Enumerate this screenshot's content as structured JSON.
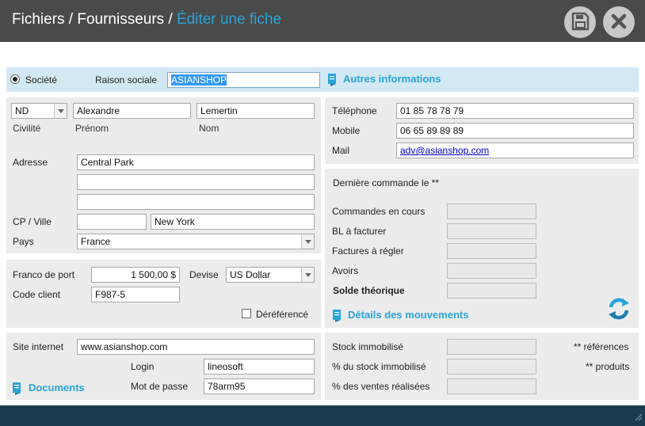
{
  "window": {
    "breadcrumb_part1": "Fichiers / Fournisseurs / ",
    "breadcrumb_active": "Éditer une fiche",
    "save_icon": "floppy-disk-icon",
    "close_icon": "close-x-icon"
  },
  "header": {
    "societe_label": "Société",
    "raison_sociale_label": "Raison sociale",
    "raison_sociale_value": "ASIANSHOP",
    "autres_informations_label": "Autres informations"
  },
  "contact": {
    "civilite_value": "ND",
    "civilite_label": "Civilité",
    "prenom_value": "Alexandre",
    "prenom_label": "Prénom",
    "nom_value": "Lemertin",
    "nom_label": "Nom",
    "adresse_label": "Adresse",
    "adresse1": "Central Park",
    "adresse2": "",
    "adresse3": "",
    "cp_ville_label": "CP / Ville",
    "cp_value": "",
    "ville_value": "New York",
    "pays_label": "Pays",
    "pays_value": "France"
  },
  "phones": {
    "telephone_label": "Téléphone",
    "telephone_value": "01 85 78 78 79",
    "mobile_label": "Mobile",
    "mobile_value": "06 65 89 89 89",
    "mail_label": "Mail",
    "mail_value": "adv@asianshop.com"
  },
  "commercial": {
    "franco_label": "Franco de port",
    "franco_value": "1 500,00 $",
    "devise_label": "Devise",
    "devise_value": "US Dollar",
    "code_client_label": "Code client",
    "code_client_value": "F987-5",
    "dereference_label": "Déréférencé"
  },
  "orders": {
    "derniere_commande_label": "Dernière commande le **",
    "commandes_en_cours_label": "Commandes en cours",
    "bl_a_facturer_label": "BL à facturer",
    "factures_a_regler_label": "Factures à régler",
    "avoirs_label": "Avoirs",
    "solde_theorique_label": "Solde théorique",
    "details_mouvements_label": "Détails des mouvements",
    "refresh_icon": "refresh-icon"
  },
  "web": {
    "site_internet_label": "Site internet",
    "site_internet_value": "www.asianshop.com",
    "login_label": "Login",
    "login_value": "lineosoft",
    "mot_de_passe_label": "Mot de passe",
    "mot_de_passe_value": "78arm95",
    "documents_label": "Documents"
  },
  "stock": {
    "stock_immobilise_label": "Stock immobilisé",
    "pct_stock_immobilise_label": "% du stock immobilisé",
    "pct_ventes_label": "% des ventes réalisées",
    "references_label": "** références",
    "produits_label": "** produits"
  },
  "colors": {
    "titlebar": "#4a4a4a",
    "accent": "#2aa5d8",
    "panel": "#ececec",
    "info_bar": "#d2e9f3",
    "footer": "#173d4f"
  }
}
